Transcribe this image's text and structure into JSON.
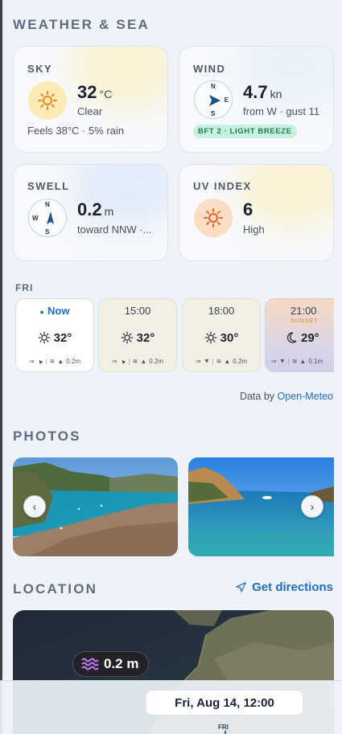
{
  "weather": {
    "section_title": "WEATHER & SEA",
    "sky": {
      "label": "SKY",
      "temp": "32",
      "unit": "°C",
      "condition": "Clear",
      "details": "Feels 38°C · 5% rain",
      "icon": "sun-icon"
    },
    "wind": {
      "label": "WIND",
      "speed": "4.7",
      "unit": "kn",
      "details": "from W · gust 11",
      "badge": "BFT 2 · LIGHT BREEZE",
      "compass": {
        "n": "N",
        "e": "E",
        "s": "S",
        "icon": "compass-arrow-icon"
      }
    },
    "swell": {
      "label": "SWELL",
      "height": "0.2",
      "unit": "m",
      "details": "toward NNW ·...",
      "compass": {
        "n": "N",
        "w": "W",
        "s": "S",
        "icon": "compass-arrow-icon"
      }
    },
    "uv": {
      "label": "UV INDEX",
      "value": "6",
      "level": "High",
      "icon": "sun-icon"
    }
  },
  "forecast": {
    "day": "FRI",
    "hours": [
      {
        "time": "Now",
        "temp": "32°",
        "icon": "sun-icon",
        "swell": "0.2m"
      },
      {
        "time": "15:00",
        "temp": "32°",
        "icon": "sun-icon",
        "swell": "0.2m"
      },
      {
        "time": "18:00",
        "temp": "30°",
        "icon": "sun-icon",
        "swell": "0.2m"
      },
      {
        "time": "21:00",
        "extra": "SUNSET",
        "temp": "29°",
        "icon": "moon-icon",
        "swell": "0.1m"
      }
    ],
    "credit_prefix": "Data by",
    "credit_link": "Open-Meteo"
  },
  "photos": {
    "section_title": "PHOTOS",
    "prev_icon": "chevron-left-icon",
    "next_icon": "chevron-right-icon"
  },
  "location": {
    "section_title": "LOCATION",
    "directions_label": "Get directions",
    "map_swell": "0.2 m"
  },
  "timeline": {
    "date": "Fri, Aug 14, 12:00",
    "day_marker": "FRI"
  },
  "colors": {
    "accent": "#1f6fc0",
    "badge_bg": "#c9f1df",
    "badge_text": "#1d7b55",
    "sun": "#ea8a1f"
  }
}
